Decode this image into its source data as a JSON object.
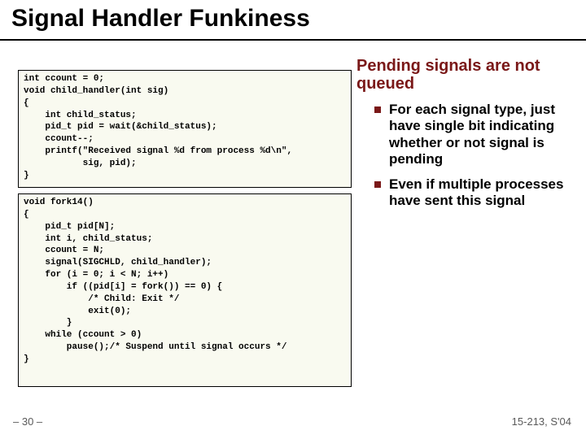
{
  "title": "Signal Handler Funkiness",
  "subhead": "Pending signals are not queued",
  "bullets": [
    "For each signal type, just have single bit indicating whether or not signal is pending",
    "Even if multiple processes have sent this signal"
  ],
  "code1": "int ccount = 0;\nvoid child_handler(int sig)\n{\n    int child_status;\n    pid_t pid = wait(&child_status);\n    ccount--;\n    printf(\"Received signal %d from process %d\\n\",\n           sig, pid);\n}",
  "code2": "void fork14()\n{\n    pid_t pid[N];\n    int i, child_status;\n    ccount = N;\n    signal(SIGCHLD, child_handler);\n    for (i = 0; i < N; i++)\n        if ((pid[i] = fork()) == 0) {\n            /* Child: Exit */\n            exit(0);\n        }\n    while (ccount > 0)\n        pause();/* Suspend until signal occurs */\n}",
  "footer_left": "– 30 –",
  "footer_right": "15-213, S'04"
}
